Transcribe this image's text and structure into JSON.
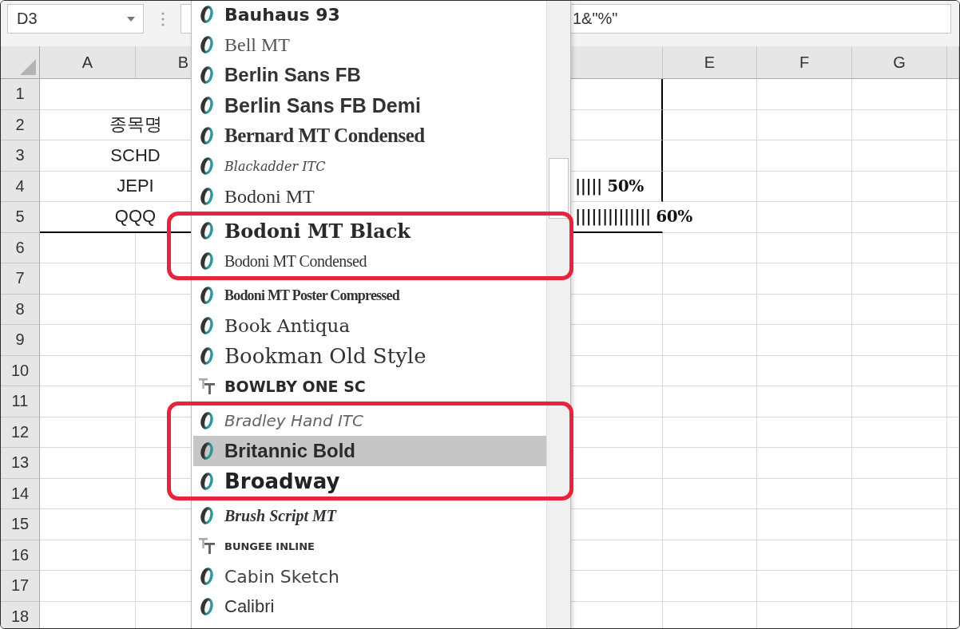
{
  "name_box": {
    "value": "D3"
  },
  "formula_bar": {
    "value": "1&\"%\""
  },
  "sheet": {
    "columns": [
      {
        "label": "A"
      },
      {
        "label": "B"
      },
      {
        "label": "E"
      },
      {
        "label": "F"
      },
      {
        "label": "G"
      }
    ],
    "rows": [
      {
        "number": "1",
        "merged": true,
        "border_right": true,
        "border_bottom": false
      },
      {
        "number": "2",
        "merged": true,
        "cell_a": "종목명",
        "border_right": true,
        "border_bottom": false
      },
      {
        "number": "3",
        "merged": true,
        "cell_a": "SCHD",
        "border_right": true,
        "border_bottom": false
      },
      {
        "number": "4",
        "merged": true,
        "cell_a": "JEPI",
        "cell_d": "||||| 50%",
        "border_right": true,
        "border_bottom": false
      },
      {
        "number": "5",
        "merged": true,
        "cell_a": "QQQ",
        "cell_d": "|||||||||||||| 60%",
        "border_right": false,
        "border_bottom": true
      },
      {
        "number": "6",
        "merged": false,
        "border_right": false,
        "border_bottom": false
      },
      {
        "number": "7",
        "merged": false,
        "border_right": false,
        "border_bottom": false
      },
      {
        "number": "8",
        "merged": false,
        "border_right": false,
        "border_bottom": false
      },
      {
        "number": "9",
        "merged": false,
        "border_right": false,
        "border_bottom": false
      },
      {
        "number": "10",
        "merged": false,
        "border_right": false,
        "border_bottom": false
      },
      {
        "number": "11",
        "merged": false,
        "border_right": false,
        "border_bottom": false
      },
      {
        "number": "12",
        "merged": false,
        "border_right": false,
        "border_bottom": false
      },
      {
        "number": "13",
        "merged": false,
        "border_right": false,
        "border_bottom": false
      },
      {
        "number": "14",
        "merged": false,
        "border_right": false,
        "border_bottom": false
      },
      {
        "number": "15",
        "merged": false,
        "border_right": false,
        "border_bottom": false
      },
      {
        "number": "16",
        "merged": false,
        "border_right": false,
        "border_bottom": false
      },
      {
        "number": "17",
        "merged": false,
        "border_right": false,
        "border_bottom": false
      },
      {
        "number": "18",
        "merged": false,
        "border_right": false,
        "border_bottom": false
      }
    ]
  },
  "font_list": {
    "items": [
      {
        "label": "Bauhaus 93",
        "kind": "opentype",
        "selected": false,
        "framed": false
      },
      {
        "label": "Bell MT",
        "kind": "opentype",
        "selected": false,
        "framed": false
      },
      {
        "label": "Berlin Sans FB",
        "kind": "opentype",
        "selected": false,
        "framed": false
      },
      {
        "label": "Berlin Sans FB Demi",
        "kind": "opentype",
        "selected": false,
        "framed": false
      },
      {
        "label": "Bernard MT Condensed",
        "kind": "opentype",
        "selected": false,
        "framed": false
      },
      {
        "label": "Blackadder ITC",
        "kind": "opentype",
        "selected": false,
        "framed": false
      },
      {
        "label": "Bodoni MT",
        "kind": "opentype",
        "selected": false,
        "framed": false
      },
      {
        "label": "Bodoni MT Black",
        "kind": "opentype",
        "selected": false,
        "framed": true
      },
      {
        "label": "Bodoni MT Condensed",
        "kind": "opentype",
        "selected": false,
        "framed": true
      },
      {
        "label": "Bodoni MT Poster Compressed",
        "kind": "opentype",
        "selected": false,
        "framed": false
      },
      {
        "label": "Book Antiqua",
        "kind": "opentype",
        "selected": false,
        "framed": false
      },
      {
        "label": "Bookman Old Style",
        "kind": "opentype",
        "selected": false,
        "framed": false
      },
      {
        "label": "BOWLBY ONE SC",
        "kind": "truetype",
        "selected": false,
        "framed": false
      },
      {
        "label": "Bradley Hand ITC",
        "kind": "opentype",
        "selected": false,
        "framed": true
      },
      {
        "label": "Britannic Bold",
        "kind": "opentype",
        "selected": true,
        "framed": true
      },
      {
        "label": "Broadway",
        "kind": "opentype",
        "selected": false,
        "framed": true
      },
      {
        "label": "Brush Script MT",
        "kind": "opentype",
        "selected": false,
        "framed": false
      },
      {
        "label": "BUNGEE INLINE",
        "kind": "truetype",
        "selected": false,
        "framed": false
      },
      {
        "label": "Cabin Sketch",
        "kind": "opentype",
        "selected": false,
        "framed": false
      },
      {
        "label": "Calibri",
        "kind": "opentype",
        "selected": false,
        "framed": false
      }
    ]
  }
}
